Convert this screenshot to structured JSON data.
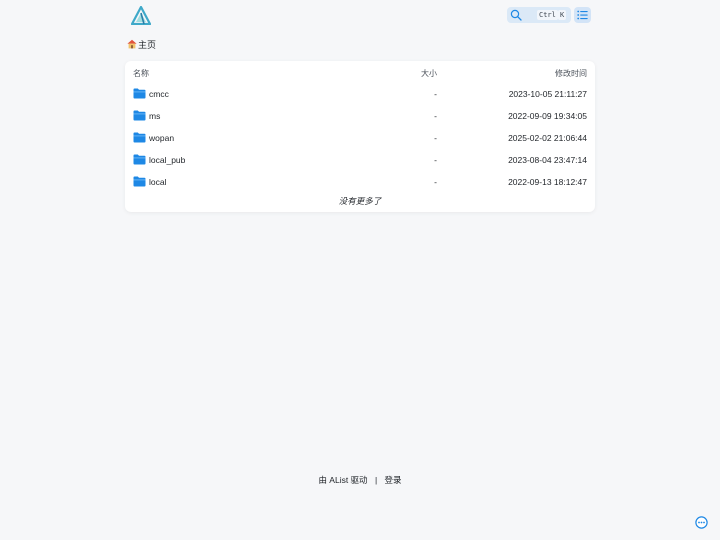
{
  "header": {
    "logo_icon": "alist-logo-icon",
    "search_icon": "search-icon",
    "search_shortcut_ctrl": "Ctrl",
    "search_shortcut_key": "K",
    "layout_icon": "list-layout-icon",
    "accent_color": "#1e88e5"
  },
  "breadcrumb": {
    "home_icon": "home-icon",
    "label": "主页"
  },
  "file_list": {
    "columns": {
      "name": "名称",
      "size": "大小",
      "modified": "修改时间"
    },
    "rows": [
      {
        "icon": "folder-icon",
        "name": "cmcc",
        "size": "-",
        "modified": "2023-10-05 21:11:27"
      },
      {
        "icon": "folder-icon",
        "name": "ms",
        "size": "-",
        "modified": "2022-09-09 19:34:05"
      },
      {
        "icon": "folder-icon",
        "name": "wopan",
        "size": "-",
        "modified": "2025-02-02 21:06:44"
      },
      {
        "icon": "folder-icon",
        "name": "local_pub",
        "size": "-",
        "modified": "2023-08-04 23:47:14"
      },
      {
        "icon": "folder-icon",
        "name": "local",
        "size": "-",
        "modified": "2022-09-13 18:12:47"
      }
    ],
    "end_text": "没有更多了"
  },
  "footer": {
    "powered_by": "由 AList 驱动",
    "separator": "|",
    "login": "登录"
  },
  "floating": {
    "more_icon": "more-options-icon"
  }
}
